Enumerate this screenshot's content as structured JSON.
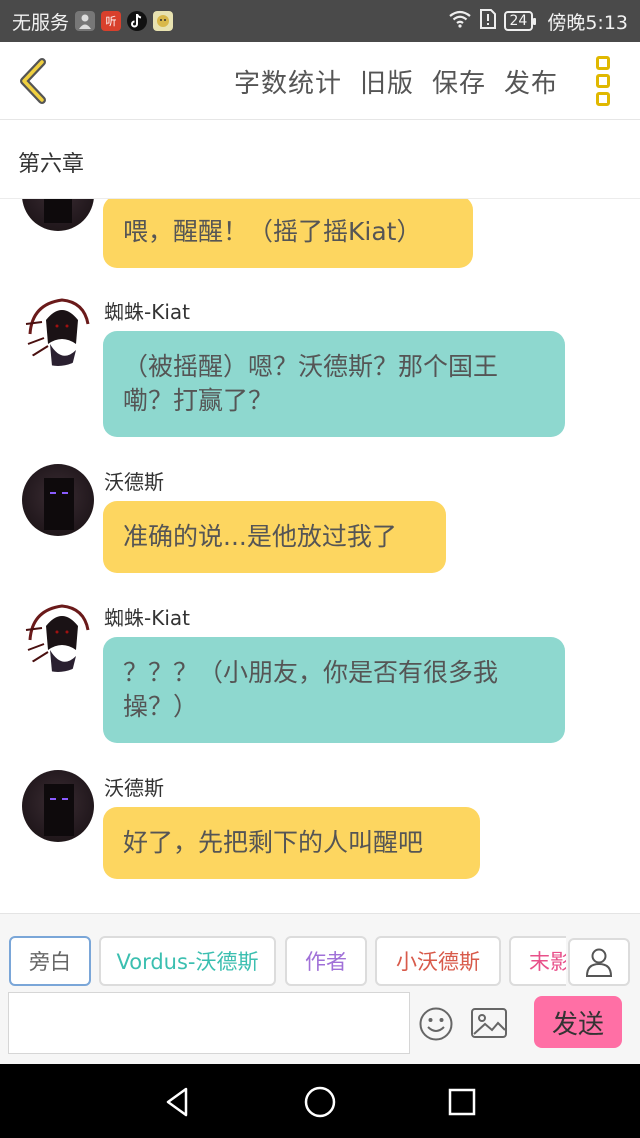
{
  "status_bar": {
    "carrier": "无服务",
    "app_tag": "听",
    "battery": "24",
    "time": "傍晚5:13"
  },
  "header": {
    "actions": [
      "字数统计",
      "旧版",
      "保存",
      "发布"
    ]
  },
  "chapter": {
    "title": "第六章"
  },
  "messages": [
    {
      "sender": "",
      "text": "喂，醒醒！（摇了摇Kiat）",
      "color": "#fdd660"
    },
    {
      "sender": "蜘蛛-Kiat",
      "text_line1": "（被摇醒）嗯？沃德斯？那个国王",
      "text_line2": "嘞？打赢了？",
      "color": "#8ed8cf"
    },
    {
      "sender": "沃德斯",
      "text": "准确的说...是他放过我了",
      "color": "#fdd660"
    },
    {
      "sender": "蜘蛛-Kiat",
      "text_line1": "？？？（小朋友，你是否有很多我",
      "text_line2": "操？）",
      "color": "#8ed8cf"
    },
    {
      "sender": "沃德斯",
      "text": "好了，先把剩下的人叫醒吧",
      "color": "#fdd660"
    }
  ],
  "roles": [
    {
      "label": "旁白",
      "color": "#666666"
    },
    {
      "label": "Vordus-沃德斯",
      "color": "#3bbfb0"
    },
    {
      "label": "作者",
      "color": "#a070d8"
    },
    {
      "label": "小沃德斯",
      "color": "#d85a4a"
    },
    {
      "label": "末影",
      "color": "#e8508a"
    }
  ],
  "composer": {
    "placeholder": "",
    "send_label": "发送"
  },
  "icons": {
    "back": "back-chevron-icon",
    "more": "more-vertical-icon",
    "profile": "user-icon",
    "emoji": "emoji-icon",
    "image": "image-icon",
    "nav_back": "triangle-back-icon",
    "nav_home": "circle-home-icon",
    "nav_recents": "square-recents-icon"
  },
  "colors": {
    "accent": "#e0b800",
    "bubble_yellow": "#fdd660",
    "bubble_teal": "#8ed8cf",
    "send": "#ff6fa5"
  }
}
